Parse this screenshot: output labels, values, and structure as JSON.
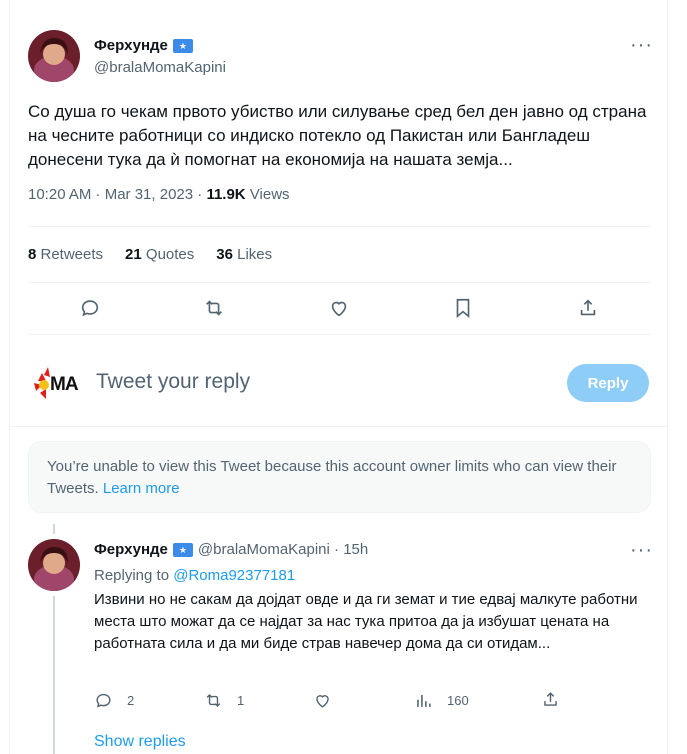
{
  "tweet": {
    "author_name": "Ферхунде",
    "author_handle": "@bralaMomaKapini",
    "more_label": "···",
    "text": "Со душа го чекам првото убиство или силување сред бел ден јавно од страна на чесните работници со индиско потекло од Пакистан или Бангладеш донесени тука да ѝ помогнат на економија на нашата земја...",
    "time": "10:20 AM · Mar 31, 2023 · ",
    "views_count": "11.9K",
    "views_label": " Views",
    "stats": {
      "retweets_count": "8",
      "retweets_label": " Retweets",
      "quotes_count": "21",
      "quotes_label": " Quotes",
      "likes_count": "36",
      "likes_label": " Likes"
    }
  },
  "reply_box": {
    "placeholder": "Tweet your reply",
    "button_label": "Reply",
    "avatar_text": "MA"
  },
  "notice": {
    "text": "You’re unable to view this Tweet because this account owner limits who can view their Tweets. ",
    "link": "Learn more"
  },
  "reply_tweet": {
    "author_name": "Ферхунде",
    "author_handle": "@bralaMomaKapini · 15h",
    "more_label": "···",
    "replying_prefix": "Replying to ",
    "replying_handle": "@Roma92377181",
    "text": "Извини но не сакам да дојдат овде и да ги земат  и тие едвај малкуте работни места што можат да се најдат за нас тука притоа да ја избушат цената на работната сила и да ми биде страв навечер дома да си отидам...",
    "replies": "2",
    "retweets": "1",
    "views": "160",
    "show_replies": "Show replies"
  },
  "colors": {
    "accent": "#1d9bf0",
    "text_primary": "#0f1419",
    "text_secondary": "#536471",
    "reply_button": "#8ecdf8",
    "verified_badge": "#3d8be8"
  }
}
